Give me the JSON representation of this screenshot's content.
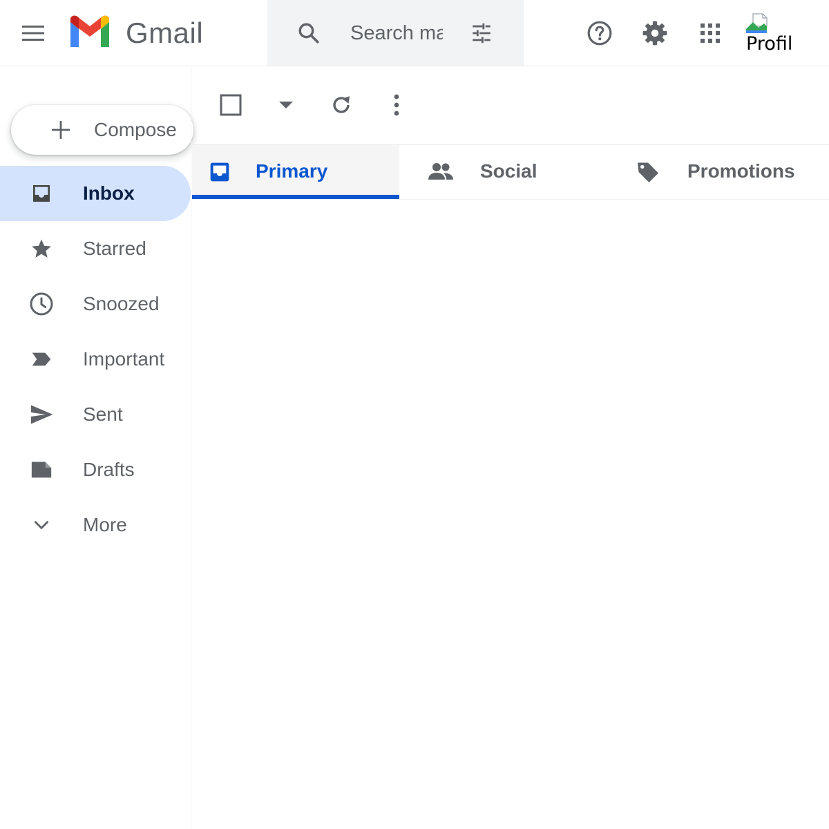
{
  "header": {
    "app_name": "Gmail",
    "search": {
      "placeholder": "Search mail"
    },
    "profile_alt": "Profile"
  },
  "compose": {
    "label": "Compose"
  },
  "sidebar": {
    "items": [
      {
        "label": "Inbox",
        "icon": "inbox-icon",
        "active": true
      },
      {
        "label": "Starred",
        "icon": "star-icon"
      },
      {
        "label": "Snoozed",
        "icon": "clock-icon"
      },
      {
        "label": "Important",
        "icon": "label-important-icon"
      },
      {
        "label": "Sent",
        "icon": "send-icon"
      },
      {
        "label": "Drafts",
        "icon": "draft-icon"
      },
      {
        "label": "More",
        "icon": "chevron-down-icon"
      }
    ]
  },
  "tabs": [
    {
      "label": "Primary",
      "icon": "inbox-tab-icon",
      "active": true
    },
    {
      "label": "Social",
      "icon": "people-icon"
    },
    {
      "label": "Promotions",
      "icon": "tag-icon"
    }
  ],
  "colors": {
    "accent": "#0b57d0",
    "active_nav_bg": "#d3e3fd",
    "icon_gray": "#5f6368",
    "search_bg": "#f1f3f4"
  }
}
